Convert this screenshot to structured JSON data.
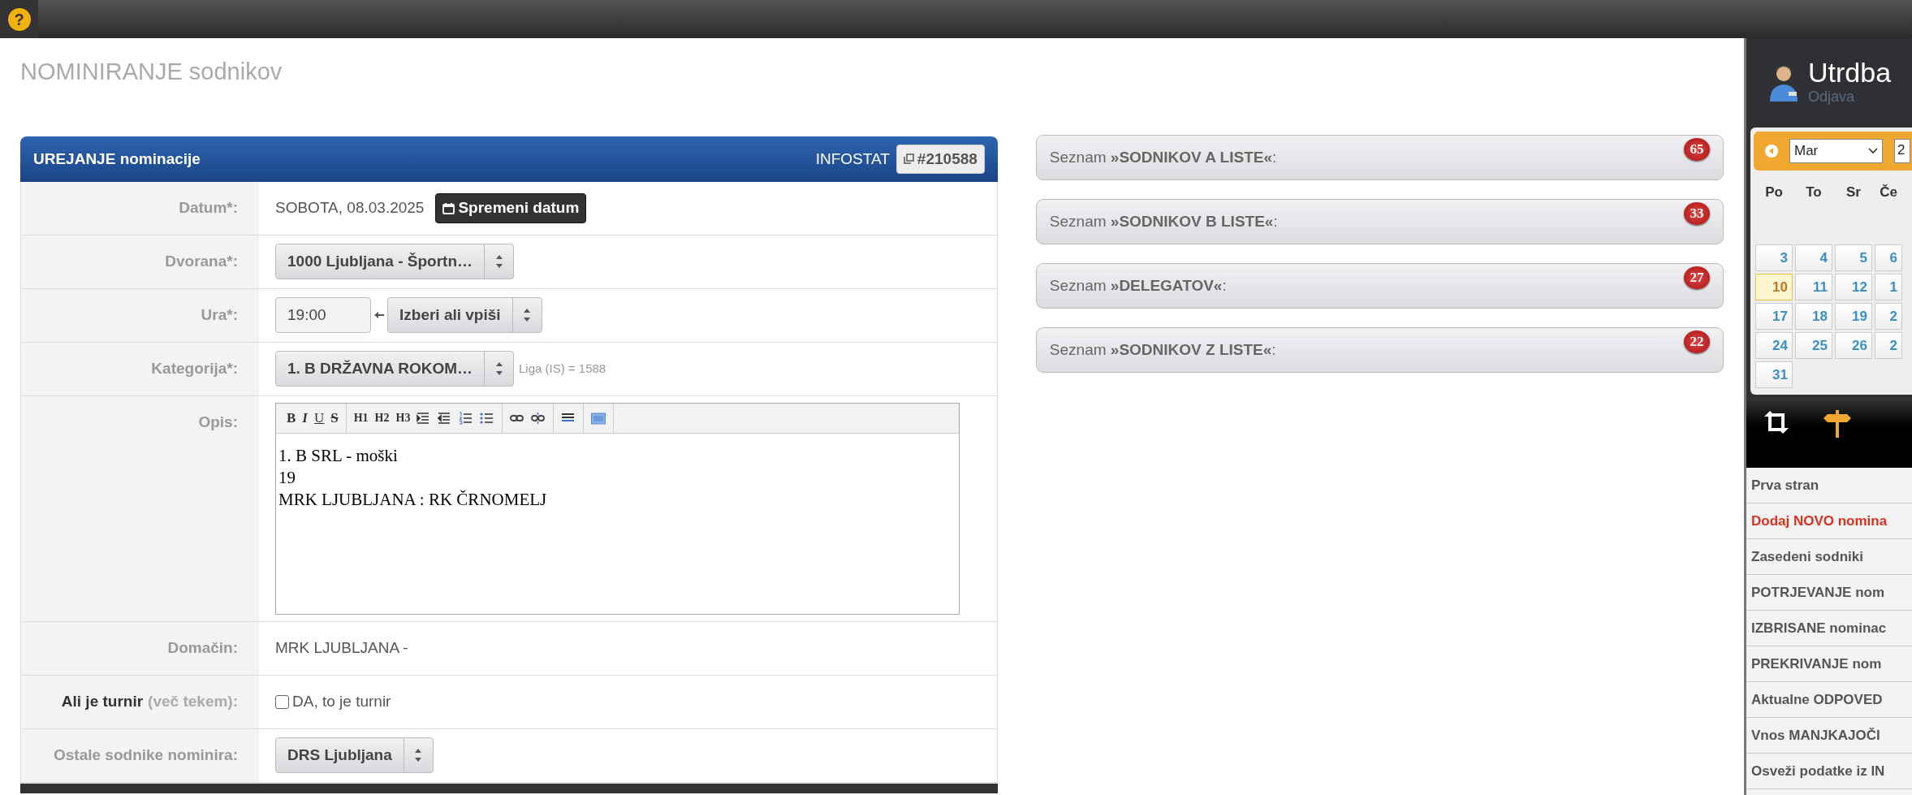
{
  "help_icon": "?",
  "page_title": "NOMINIRANJE sodnikov",
  "form": {
    "title": "UREJANJE nominacije",
    "infostat_label": "INFOSTAT",
    "infostat_id": "#210588",
    "rows": [
      {
        "kind": "date",
        "label": "Datum*:",
        "value": "SOBOTA, 08.03.2025",
        "button": "Spremeni datum"
      },
      {
        "kind": "select",
        "label": "Dvorana*:",
        "value": "1000 Ljubljana - Športn…"
      },
      {
        "kind": "time",
        "label": "Ura*:",
        "value": "19:00",
        "select": "Izberi ali vpiši"
      },
      {
        "kind": "select",
        "label": "Kategorija*:",
        "value": "1. B DRŽAVNA ROKOM…",
        "note": "Liga (IS) = 1588"
      },
      {
        "kind": "editor",
        "label": "Opis:",
        "lines": [
          "1. B SRL - moški",
          "19",
          "MRK LJUBLJANA : RK ČRNOMELJ"
        ],
        "toolbar": [
          [
            {
              "kind": "bold",
              "label": "B"
            },
            {
              "kind": "italic",
              "label": "I"
            },
            {
              "kind": "underline",
              "label": "U"
            },
            {
              "kind": "strike",
              "label": "S"
            }
          ],
          [
            {
              "kind": "heading",
              "label": "H1"
            },
            {
              "kind": "heading",
              "label": "H2"
            },
            {
              "kind": "heading",
              "label": "H3"
            },
            {
              "kind": "indent"
            },
            {
              "kind": "outdent"
            },
            {
              "kind": "ordered-list"
            },
            {
              "kind": "bullet-list"
            }
          ],
          [
            {
              "kind": "link"
            },
            {
              "kind": "unlink"
            }
          ],
          [
            {
              "kind": "rule"
            }
          ],
          [
            {
              "kind": "html"
            }
          ]
        ]
      },
      {
        "kind": "text",
        "label": "Domačin:",
        "value": "MRK LJUBLJANA -"
      },
      {
        "kind": "checkbox",
        "label": "Ali je turnir",
        "label_note": "(več tekem):",
        "emphasis": true,
        "checked": false,
        "value": "DA, to je turnir"
      },
      {
        "kind": "select",
        "label": "Ostale sodnike nominira:",
        "value": "DRS Ljubljana"
      }
    ]
  },
  "lists": [
    {
      "prefix": "Seznam",
      "name": "»SODNIKOV A LISTE«",
      "suffix": ":",
      "count": "65"
    },
    {
      "prefix": "Seznam",
      "name": "»SODNIKOV B LISTE«",
      "suffix": ":",
      "count": "33"
    },
    {
      "prefix": "Seznam",
      "name": "»DELEGATOV«",
      "suffix": ":",
      "count": "27"
    },
    {
      "prefix": "Seznam",
      "name": "»SODNIKOV Z LISTE«",
      "suffix": ":",
      "count": "22"
    }
  ],
  "sidebar": {
    "user": "Utrdba",
    "logout": "Odjava",
    "calendar": {
      "month": "Mar",
      "year": "2",
      "weekdays": [
        "Po",
        "To",
        "Sr",
        "Če"
      ],
      "weeks": [
        [
          {
            "day": "3",
            "today": false
          },
          {
            "day": "4",
            "today": false
          },
          {
            "day": "5",
            "today": false
          },
          {
            "day": "6",
            "today": false
          }
        ],
        [
          {
            "day": "10",
            "today": true
          },
          {
            "day": "11",
            "today": false
          },
          {
            "day": "12",
            "today": false
          },
          {
            "day": "1",
            "today": false
          }
        ],
        [
          {
            "day": "17",
            "today": false
          },
          {
            "day": "18",
            "today": false
          },
          {
            "day": "19",
            "today": false
          },
          {
            "day": "2",
            "today": false
          }
        ],
        [
          {
            "day": "24",
            "today": false
          },
          {
            "day": "25",
            "today": false
          },
          {
            "day": "26",
            "today": false
          },
          {
            "day": "2",
            "today": false
          }
        ],
        [
          {
            "day": "31",
            "today": false
          }
        ]
      ]
    },
    "menu": [
      {
        "label": "Prva stran",
        "highlighted": false
      },
      {
        "label": "Dodaj NOVO nomina",
        "highlighted": true
      },
      {
        "label": "Zasedeni sodniki",
        "highlighted": false
      },
      {
        "label": "POTRJEVANJE nom",
        "highlighted": false
      },
      {
        "label": "IZBRISANE nominac",
        "highlighted": false
      },
      {
        "label": "PREKRIVANJE nom",
        "highlighted": false
      },
      {
        "label": "Aktualne ODPOVED",
        "highlighted": false
      },
      {
        "label": "Vnos MANJKAJOČI",
        "highlighted": false
      },
      {
        "label": "Osveži podatke iz IN",
        "highlighted": false
      }
    ]
  }
}
